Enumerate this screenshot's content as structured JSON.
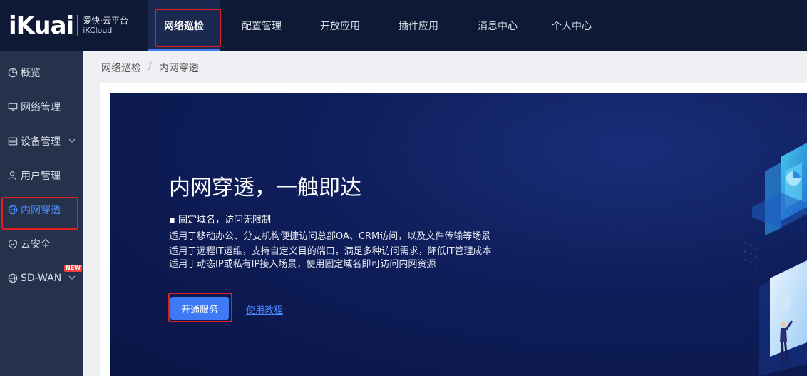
{
  "header": {
    "logo_mark": "iKuai",
    "logo_cn": "爱快·云平台",
    "logo_en": "iKCloud",
    "nav": [
      {
        "label": "网络巡检",
        "active": true
      },
      {
        "label": "配置管理",
        "active": false
      },
      {
        "label": "开放应用",
        "active": false
      },
      {
        "label": "插件应用",
        "active": false
      },
      {
        "label": "消息中心",
        "active": false
      },
      {
        "label": "个人中心",
        "active": false
      }
    ]
  },
  "sidebar": {
    "items": [
      {
        "label": "概览",
        "icon": "pie-chart-icon",
        "expandable": false,
        "active": false
      },
      {
        "label": "网络管理",
        "icon": "monitor-icon",
        "expandable": false,
        "active": false
      },
      {
        "label": "设备管理",
        "icon": "server-icon",
        "expandable": true,
        "active": false
      },
      {
        "label": "用户管理",
        "icon": "user-icon",
        "expandable": false,
        "active": false
      },
      {
        "label": "内网穿透",
        "icon": "globe-icon",
        "expandable": false,
        "active": true
      },
      {
        "label": "云安全",
        "icon": "shield-icon",
        "expandable": false,
        "active": false
      },
      {
        "label": "SD-WAN",
        "icon": "globe-icon",
        "expandable": true,
        "active": false,
        "badge": "NEW"
      }
    ]
  },
  "breadcrumb": {
    "parent": "网络巡检",
    "separator": "/",
    "current": "内网穿透"
  },
  "banner": {
    "title": "内网穿透，一触即达",
    "bullet": "固定域名，访问无限制",
    "lines": [
      "适用于移动办公、分支机构便捷访问总部OA、CRM访问，以及文件传输等场景",
      "适用于远程IT运维，支持自定义目的端口，满足多种访问需求，降低IT管理成本",
      "适用于动态IP或私有IP接入场景，使用固定域名即可访问内网资源"
    ],
    "primary_button": "开通服务",
    "link": "使用教程"
  },
  "colors": {
    "topbar": "#0d1935",
    "sidebar": "#26324b",
    "accent": "#3f7af6",
    "highlight": "#e02020"
  }
}
